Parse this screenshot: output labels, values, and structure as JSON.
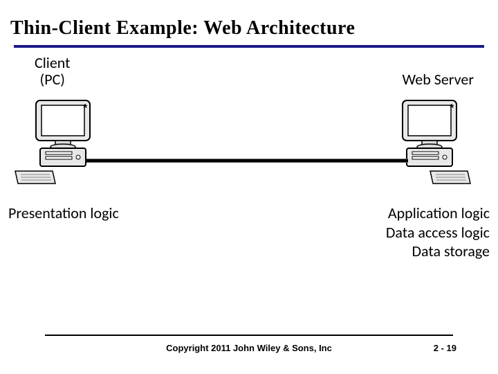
{
  "title": "Thin-Client Example: Web Architecture",
  "client": {
    "label_line1": "Client",
    "label_line2": "(PC)"
  },
  "server": {
    "label": "Web Server"
  },
  "client_logic": "Presentation logic",
  "server_logic": {
    "line1": "Application logic",
    "line2": "Data access logic",
    "line3": "Data storage"
  },
  "footer": {
    "copyright": "Copyright 2011 John Wiley & Sons, Inc",
    "page": "2 - 19"
  }
}
